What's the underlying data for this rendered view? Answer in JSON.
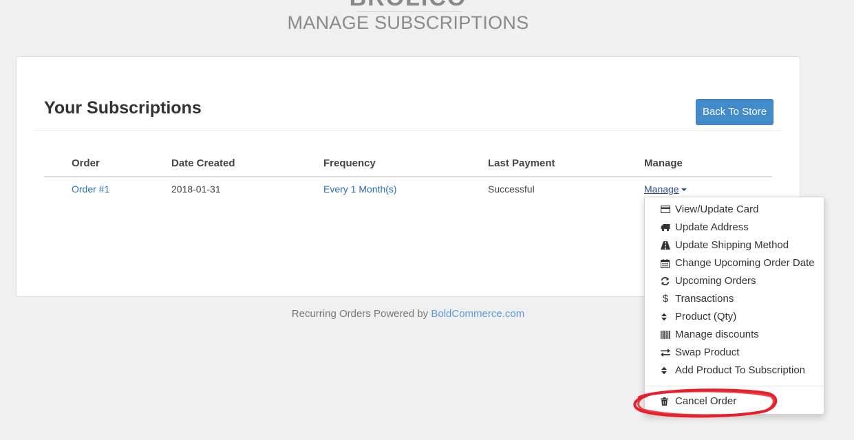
{
  "header": {
    "store_name": "BROLICO",
    "title": "MANAGE SUBSCRIPTIONS"
  },
  "card": {
    "title": "Your Subscriptions",
    "back_button": "Back To Store"
  },
  "table": {
    "columns": [
      "Order",
      "Date Created",
      "Frequency",
      "Last Payment",
      "Manage"
    ],
    "rows": [
      {
        "order": "Order #1",
        "date_created": "2018-01-31",
        "frequency": "Every 1 Month(s)",
        "last_payment": "Successful",
        "manage": "Manage"
      }
    ]
  },
  "dropdown": {
    "items": [
      {
        "label": "View/Update Card",
        "icon": "credit-card-icon"
      },
      {
        "label": "Update Address",
        "icon": "truck-icon"
      },
      {
        "label": "Update Shipping Method",
        "icon": "road-icon"
      },
      {
        "label": "Change Upcoming Order Date",
        "icon": "calendar-icon"
      },
      {
        "label": "Upcoming Orders",
        "icon": "refresh-icon"
      },
      {
        "label": "Transactions",
        "icon": "dollar-icon"
      },
      {
        "label": "Product (Qty)",
        "icon": "sort-icon"
      },
      {
        "label": "Manage discounts",
        "icon": "barcode-icon"
      },
      {
        "label": "Swap Product",
        "icon": "exchange-icon"
      },
      {
        "label": "Add Product To Subscription",
        "icon": "sort-icon"
      }
    ],
    "cancel": {
      "label": "Cancel Order",
      "icon": "trash-icon"
    }
  },
  "footer": {
    "text": "Recurring Orders Powered by",
    "link": "BoldCommerce.com"
  },
  "annotation_color": "#e8202a"
}
